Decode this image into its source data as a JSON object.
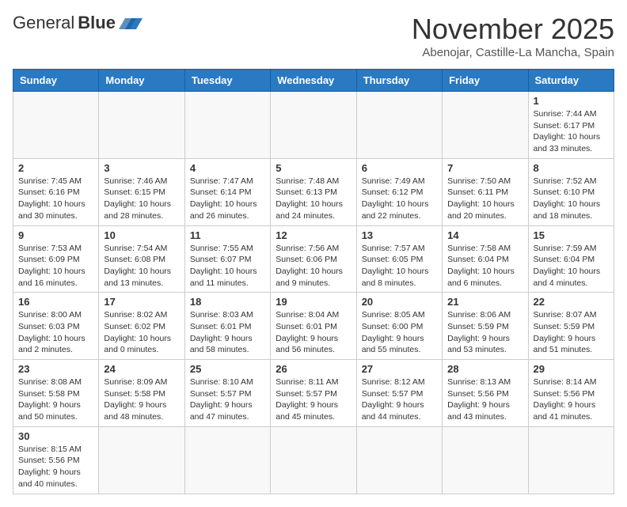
{
  "logo": {
    "general": "General",
    "blue": "Blue"
  },
  "header": {
    "month": "November 2025",
    "location": "Abenojar, Castille-La Mancha, Spain"
  },
  "days_of_week": [
    "Sunday",
    "Monday",
    "Tuesday",
    "Wednesday",
    "Thursday",
    "Friday",
    "Saturday"
  ],
  "weeks": [
    [
      {
        "day": "",
        "info": ""
      },
      {
        "day": "",
        "info": ""
      },
      {
        "day": "",
        "info": ""
      },
      {
        "day": "",
        "info": ""
      },
      {
        "day": "",
        "info": ""
      },
      {
        "day": "",
        "info": ""
      },
      {
        "day": "1",
        "info": "Sunrise: 7:44 AM\nSunset: 6:17 PM\nDaylight: 10 hours\nand 33 minutes."
      }
    ],
    [
      {
        "day": "2",
        "info": "Sunrise: 7:45 AM\nSunset: 6:16 PM\nDaylight: 10 hours\nand 30 minutes."
      },
      {
        "day": "3",
        "info": "Sunrise: 7:46 AM\nSunset: 6:15 PM\nDaylight: 10 hours\nand 28 minutes."
      },
      {
        "day": "4",
        "info": "Sunrise: 7:47 AM\nSunset: 6:14 PM\nDaylight: 10 hours\nand 26 minutes."
      },
      {
        "day": "5",
        "info": "Sunrise: 7:48 AM\nSunset: 6:13 PM\nDaylight: 10 hours\nand 24 minutes."
      },
      {
        "day": "6",
        "info": "Sunrise: 7:49 AM\nSunset: 6:12 PM\nDaylight: 10 hours\nand 22 minutes."
      },
      {
        "day": "7",
        "info": "Sunrise: 7:50 AM\nSunset: 6:11 PM\nDaylight: 10 hours\nand 20 minutes."
      },
      {
        "day": "8",
        "info": "Sunrise: 7:52 AM\nSunset: 6:10 PM\nDaylight: 10 hours\nand 18 minutes."
      }
    ],
    [
      {
        "day": "9",
        "info": "Sunrise: 7:53 AM\nSunset: 6:09 PM\nDaylight: 10 hours\nand 16 minutes."
      },
      {
        "day": "10",
        "info": "Sunrise: 7:54 AM\nSunset: 6:08 PM\nDaylight: 10 hours\nand 13 minutes."
      },
      {
        "day": "11",
        "info": "Sunrise: 7:55 AM\nSunset: 6:07 PM\nDaylight: 10 hours\nand 11 minutes."
      },
      {
        "day": "12",
        "info": "Sunrise: 7:56 AM\nSunset: 6:06 PM\nDaylight: 10 hours\nand 9 minutes."
      },
      {
        "day": "13",
        "info": "Sunrise: 7:57 AM\nSunset: 6:05 PM\nDaylight: 10 hours\nand 8 minutes."
      },
      {
        "day": "14",
        "info": "Sunrise: 7:58 AM\nSunset: 6:04 PM\nDaylight: 10 hours\nand 6 minutes."
      },
      {
        "day": "15",
        "info": "Sunrise: 7:59 AM\nSunset: 6:04 PM\nDaylight: 10 hours\nand 4 minutes."
      }
    ],
    [
      {
        "day": "16",
        "info": "Sunrise: 8:00 AM\nSunset: 6:03 PM\nDaylight: 10 hours\nand 2 minutes."
      },
      {
        "day": "17",
        "info": "Sunrise: 8:02 AM\nSunset: 6:02 PM\nDaylight: 10 hours\nand 0 minutes."
      },
      {
        "day": "18",
        "info": "Sunrise: 8:03 AM\nSunset: 6:01 PM\nDaylight: 9 hours\nand 58 minutes."
      },
      {
        "day": "19",
        "info": "Sunrise: 8:04 AM\nSunset: 6:01 PM\nDaylight: 9 hours\nand 56 minutes."
      },
      {
        "day": "20",
        "info": "Sunrise: 8:05 AM\nSunset: 6:00 PM\nDaylight: 9 hours\nand 55 minutes."
      },
      {
        "day": "21",
        "info": "Sunrise: 8:06 AM\nSunset: 5:59 PM\nDaylight: 9 hours\nand 53 minutes."
      },
      {
        "day": "22",
        "info": "Sunrise: 8:07 AM\nSunset: 5:59 PM\nDaylight: 9 hours\nand 51 minutes."
      }
    ],
    [
      {
        "day": "23",
        "info": "Sunrise: 8:08 AM\nSunset: 5:58 PM\nDaylight: 9 hours\nand 50 minutes."
      },
      {
        "day": "24",
        "info": "Sunrise: 8:09 AM\nSunset: 5:58 PM\nDaylight: 9 hours\nand 48 minutes."
      },
      {
        "day": "25",
        "info": "Sunrise: 8:10 AM\nSunset: 5:57 PM\nDaylight: 9 hours\nand 47 minutes."
      },
      {
        "day": "26",
        "info": "Sunrise: 8:11 AM\nSunset: 5:57 PM\nDaylight: 9 hours\nand 45 minutes."
      },
      {
        "day": "27",
        "info": "Sunrise: 8:12 AM\nSunset: 5:57 PM\nDaylight: 9 hours\nand 44 minutes."
      },
      {
        "day": "28",
        "info": "Sunrise: 8:13 AM\nSunset: 5:56 PM\nDaylight: 9 hours\nand 43 minutes."
      },
      {
        "day": "29",
        "info": "Sunrise: 8:14 AM\nSunset: 5:56 PM\nDaylight: 9 hours\nand 41 minutes."
      }
    ],
    [
      {
        "day": "30",
        "info": "Sunrise: 8:15 AM\nSunset: 5:56 PM\nDaylight: 9 hours\nand 40 minutes."
      },
      {
        "day": "",
        "info": ""
      },
      {
        "day": "",
        "info": ""
      },
      {
        "day": "",
        "info": ""
      },
      {
        "day": "",
        "info": ""
      },
      {
        "day": "",
        "info": ""
      },
      {
        "day": "",
        "info": ""
      }
    ]
  ]
}
